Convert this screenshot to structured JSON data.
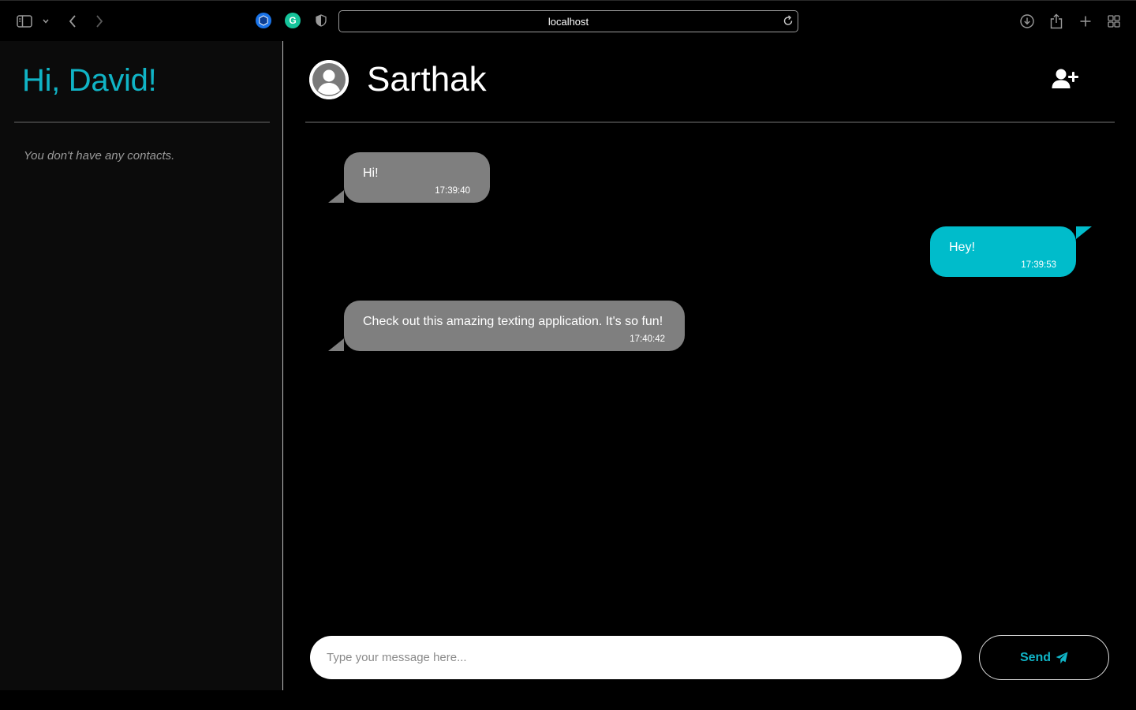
{
  "browser": {
    "url": "localhost",
    "toolbar_icons": [
      "sidebar-toggle-icon",
      "chevron-down-icon",
      "back-arrow-icon",
      "forward-arrow-icon",
      "downloads-icon",
      "share-icon",
      "new-tab-icon",
      "tab-overview-icon"
    ],
    "extensions": [
      {
        "name": "privacy-extension-icon",
        "color": "#1a73e8"
      },
      {
        "name": "grammarly-icon",
        "color": "#15c39a",
        "glyph": "G"
      },
      {
        "name": "shield-icon",
        "color": "#9a9a9a"
      }
    ]
  },
  "sidebar": {
    "greeting": "Hi, David!",
    "empty_state": "You don't have any contacts."
  },
  "chat": {
    "contact_name": "Sarthak",
    "add_contact_icon": "add-user-icon",
    "messages": [
      {
        "direction": "incoming",
        "text": "Hi!",
        "time": "17:39:40"
      },
      {
        "direction": "outgoing",
        "text": "Hey!",
        "time": "17:39:53"
      },
      {
        "direction": "incoming",
        "text": "Check out this amazing texting application. It's so fun!",
        "time": "17:40:42"
      }
    ],
    "composer": {
      "placeholder": "Type your message here...",
      "value": "",
      "send_label": "Send",
      "send_icon": "paper-plane-icon"
    }
  },
  "colors": {
    "accent": "#10b4c6",
    "outgoing_bubble": "#00bccb",
    "incoming_bubble": "#7f7f7f",
    "sidebar_bg": "#0b0b0b",
    "background": "#000000"
  }
}
